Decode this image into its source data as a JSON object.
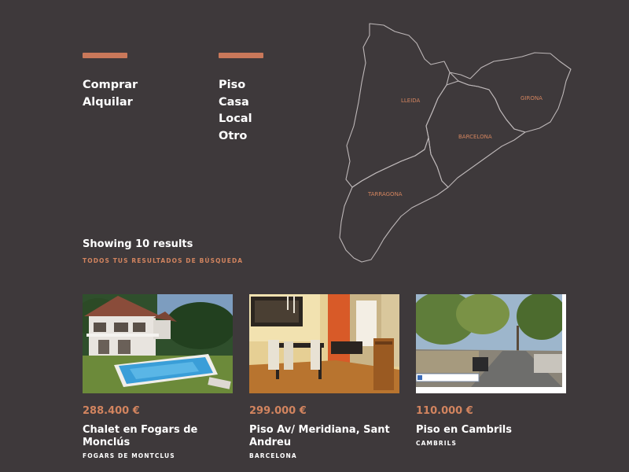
{
  "filters": {
    "operations": [
      "Comprar",
      "Alquilar"
    ],
    "types": [
      "Piso",
      "Casa",
      "Local",
      "Otro"
    ]
  },
  "map": {
    "regions": [
      "LLEIDA",
      "GIRONA",
      "BARCELONA",
      "TARRAGONA"
    ]
  },
  "results": {
    "count_label": "Showing 10 results",
    "subtitle": "TODOS TUS RESULTADOS DE BÚSQUEDA"
  },
  "listings": [
    {
      "price": "288.400 €",
      "title": "Chalet en Fogars de Monclús",
      "location": "FOGARS DE MONTCLUS"
    },
    {
      "price": "299.000 €",
      "title": "Piso Av/ Meridiana, Sant Andreu",
      "location": "BARCELONA"
    },
    {
      "price": "110.000 €",
      "title": "Piso en Cambrils",
      "location": "CAMBRILS"
    }
  ],
  "colors": {
    "background": "#3e393b",
    "accent": "#c9785a",
    "region_label": "#d2845f"
  }
}
